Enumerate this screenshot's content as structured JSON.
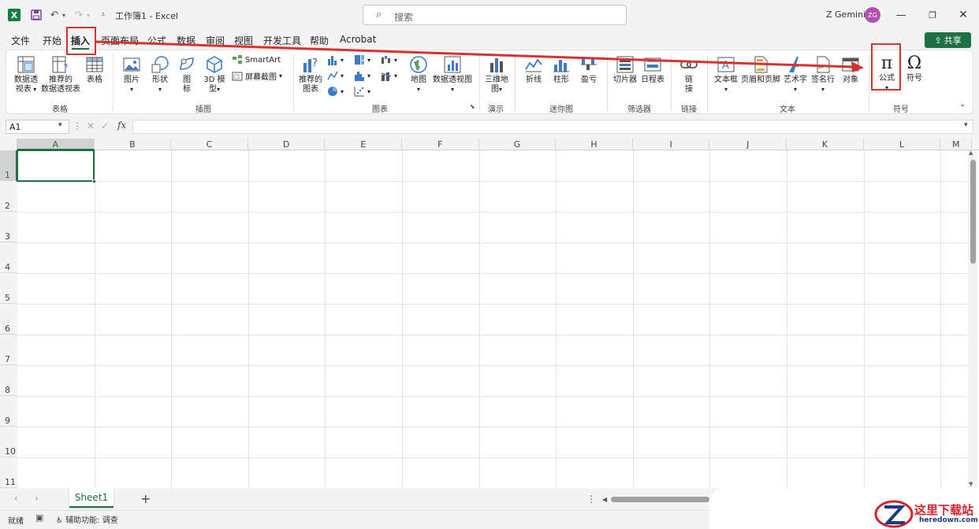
{
  "titlebar": {
    "app_icon": "X",
    "doc_title": "工作簿1  -  Excel",
    "search_placeholder": "搜索",
    "user_name": "Z Gemini",
    "avatar_initials": "ZG"
  },
  "tabs": [
    "文件",
    "开始",
    "插入",
    "页面布局",
    "公式",
    "数据",
    "审阅",
    "视图",
    "开发工具",
    "帮助",
    "Acrobat"
  ],
  "active_tab": "插入",
  "share_label": "共享",
  "ribbon": {
    "tables": {
      "pivot": "数据透\n视表",
      "rec_pivot": "推荐的\n数据透视表",
      "table": "表格",
      "label": "表格"
    },
    "illustrations": {
      "picture": "图片",
      "shapes": "形状",
      "icons": "图\n标",
      "model3d": "3D 模\n型",
      "smartart": "SmartArt",
      "screenshot": "屏幕截图",
      "label": "插图"
    },
    "charts": {
      "rec_charts": "推荐的\n图表",
      "label": "图表"
    },
    "maps": {
      "map": "地图",
      "pivot_chart": "数据透视图"
    },
    "tours": {
      "map3d": "三维地\n图",
      "label": "演示"
    },
    "sparklines": {
      "line": "折线",
      "column": "柱形",
      "winloss": "盈亏",
      "label": "迷你图"
    },
    "filters": {
      "slicer": "切片器",
      "timeline": "日程表",
      "label": "筛选器"
    },
    "links": {
      "link": "链\n接",
      "label": "链接"
    },
    "text": {
      "textbox": "文本框",
      "header_footer": "页眉和页脚",
      "wordart": "艺术字",
      "signature": "签名行",
      "object": "对象",
      "label": "文本"
    },
    "symbols": {
      "equation": "公式",
      "symbol": "符号",
      "label": "符号"
    }
  },
  "formula_bar": {
    "name_box": "A1",
    "fx": "fx",
    "value": ""
  },
  "columns": [
    "A",
    "B",
    "C",
    "D",
    "E",
    "F",
    "G",
    "H",
    "I",
    "J",
    "K",
    "L",
    "M"
  ],
  "rows": [
    "1",
    "2",
    "3",
    "4",
    "5",
    "6",
    "7",
    "8",
    "9",
    "10",
    "11"
  ],
  "selected_cell": "A1",
  "sheets": [
    "Sheet1"
  ],
  "status": {
    "ready": "就绪",
    "accessibility": "辅助功能: 调查"
  },
  "watermark": {
    "cn": "这里下载站",
    "en": "heredown.com"
  },
  "colors": {
    "excel_green": "#1e7145",
    "annotation_red": "#d9312c"
  }
}
